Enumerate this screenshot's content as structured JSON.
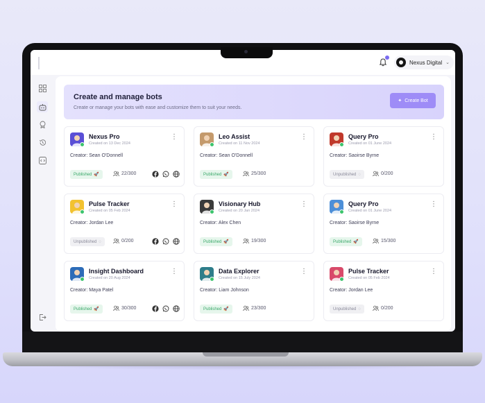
{
  "header": {
    "profile_name": "Nexus Digital",
    "notification_icon": "bell-icon"
  },
  "sidebar": {
    "items": [
      {
        "name": "dashboard",
        "icon": "grid-icon"
      },
      {
        "name": "bots",
        "icon": "bot-icon",
        "active": true
      },
      {
        "name": "templates",
        "icon": "badge-icon"
      },
      {
        "name": "history",
        "icon": "history-icon"
      },
      {
        "name": "integrations",
        "icon": "code-icon"
      }
    ],
    "logout_icon": "logout-icon"
  },
  "banner": {
    "title": "Create and manage bots",
    "subtitle": "Create or manage your bots with ease and customize them to suit your needs.",
    "create_button": "Create Bot"
  },
  "bots": [
    {
      "name": "Nexus Pro",
      "created": "Created on 13 Dec 2024",
      "creator": "Creator: Sean O'Donnell",
      "status": "Published",
      "users": "22/300",
      "socials": true,
      "avatar_color": "#5a4fd6"
    },
    {
      "name": "Leo Assist",
      "created": "Created on 11 Nov 2024",
      "creator": "Creator: Sean O'Donnell",
      "status": "Published",
      "users": "25/300",
      "socials": false,
      "avatar_color": "#c49a6c"
    },
    {
      "name": "Query Pro",
      "created": "Created on 01 June 2024",
      "creator": "Creator: Saoirse Byrne",
      "status": "Unpublished",
      "users": "0/200",
      "socials": false,
      "avatar_color": "#c0392b"
    },
    {
      "name": "Pulse Tracker",
      "created": "Created on 05 Feb 2024",
      "creator": "Creator: Jordan Lee",
      "status": "Unpublished",
      "users": "0/200",
      "socials": true,
      "avatar_color": "#f2c230"
    },
    {
      "name": "Visionary Hub",
      "created": "Created on 20 Jan 2024",
      "creator": "Creator: Alex Chen",
      "status": "Published",
      "users": "19/300",
      "socials": false,
      "avatar_color": "#3b3b3b"
    },
    {
      "name": "Query Pro",
      "created": "Created on 01 June 2024",
      "creator": "Creator: Saoirse Byrne",
      "status": "Published",
      "users": "15/300",
      "socials": false,
      "avatar_color": "#4d8fd8"
    },
    {
      "name": "Insight Dashboard",
      "created": "Created on 20 Aug 2024",
      "creator": "Creator: Maya Patel",
      "status": "Published",
      "users": "30/300",
      "socials": true,
      "avatar_color": "#2d6cb8"
    },
    {
      "name": "Data Explorer",
      "created": "Created on 15 July 2024",
      "creator": "Creator: Liam Johnson",
      "status": "Published",
      "users": "23/300",
      "socials": false,
      "avatar_color": "#2e7d8a"
    },
    {
      "name": "Pulse Tracker",
      "created": "Created on 05 Feb 2024",
      "creator": "Creator: Jordan Lee",
      "status": "Unpublished",
      "users": "0/200",
      "socials": false,
      "avatar_color": "#d84a6a"
    }
  ],
  "colors": {
    "accent": "#9e8cf7",
    "published_bg": "#e6f6ec",
    "published_text": "#3aa86a",
    "online": "#3cc46d"
  }
}
